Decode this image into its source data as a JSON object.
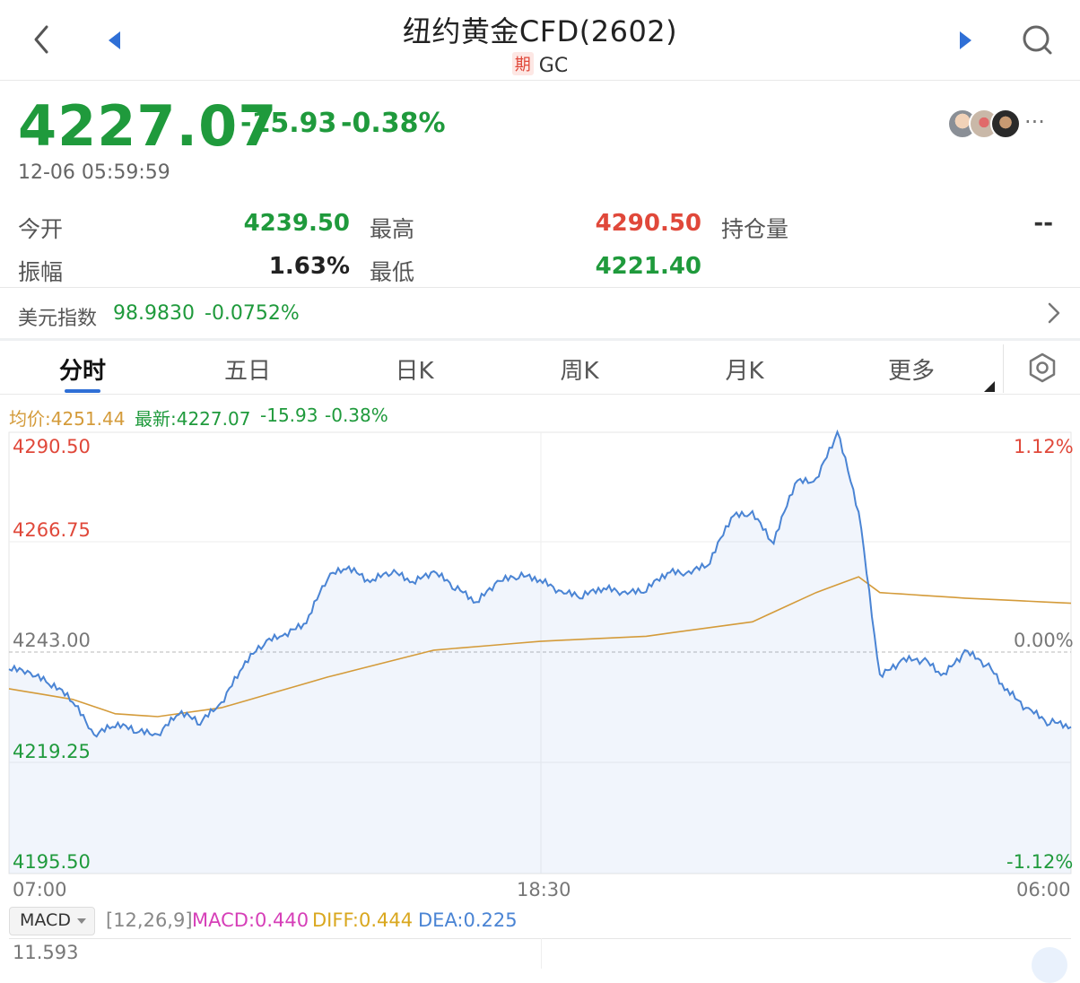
{
  "header": {
    "title": "纽约黄金CFD(2602)",
    "badge": "期",
    "code": "GC"
  },
  "quote": {
    "price": "4227.07",
    "change": "-15.93",
    "change_pct": "-0.38%",
    "timestamp": "12-06 05:59:59",
    "more": "···"
  },
  "stats": {
    "open_label": "今开",
    "open_value": "4239.50",
    "high_label": "最高",
    "high_value": "4290.50",
    "oi_label": "持仓量",
    "oi_value": "--",
    "amp_label": "振幅",
    "amp_value": "1.63%",
    "low_label": "最低",
    "low_value": "4221.40"
  },
  "usd_index": {
    "label": "美元指数",
    "value": "98.9830",
    "change_pct": "-0.0752%"
  },
  "tabs": [
    "分时",
    "五日",
    "日K",
    "周K",
    "月K",
    "更多"
  ],
  "active_tab": "分时",
  "legend": {
    "avg": "均价:4251.44",
    "latest": "最新:4227.07",
    "change": "-15.93",
    "change_pct": "-0.38%"
  },
  "axis": {
    "left": [
      "4290.50",
      "4266.75",
      "4243.00",
      "4219.25",
      "4195.50"
    ],
    "right_top": "1.12%",
    "right_mid": "0.00%",
    "right_bottom": "-1.12%",
    "x": [
      "07:00",
      "18:30",
      "06:00"
    ]
  },
  "macd": {
    "selector": "MACD",
    "params": "[12,26,9]",
    "macd": "MACD:0.440",
    "diff": "DIFF:0.444",
    "dea": "DEA:0.225",
    "axis_top": "11.593"
  },
  "colors": {
    "up": "#e0483a",
    "down": "#1f9a3c",
    "price_line": "#4a84d4",
    "avg_line": "#d49b3a",
    "accent": "#2f6fd6"
  },
  "chart_data": {
    "type": "line",
    "title": "",
    "xlabel": "",
    "ylabel": "",
    "x_ticks": [
      "07:00",
      "18:30",
      "06:00"
    ],
    "ylim": [
      4195.5,
      4290.5
    ],
    "reference": 4243.0,
    "series": [
      {
        "name": "最新",
        "x": [
          0,
          1,
          2,
          3,
          4,
          5,
          6,
          7,
          8,
          9,
          10,
          11,
          12,
          13,
          14,
          15,
          16,
          17,
          18,
          19,
          20,
          21,
          22,
          23,
          24,
          25,
          26,
          27,
          28,
          29,
          30,
          31,
          32,
          33,
          34,
          35,
          36,
          37,
          38,
          39,
          40,
          41,
          42,
          43,
          44,
          45,
          46,
          47,
          48,
          49,
          50
        ],
        "values": [
          4239.5,
          4238.2,
          4236.0,
          4232.5,
          4224.8,
          4227.3,
          4226.0,
          4224.8,
          4229.9,
          4227.8,
          4231.7,
          4239.8,
          4245.0,
          4246.5,
          4249.2,
          4259.2,
          4261.0,
          4257.9,
          4260.4,
          4257.8,
          4260.1,
          4256.9,
          4253.5,
          4257.9,
          4259.4,
          4258.4,
          4255.6,
          4255.0,
          4256.7,
          4255.4,
          4256.3,
          4260.1,
          4259.7,
          4262.2,
          4272.1,
          4272.6,
          4266.4,
          4279.5,
          4279.7,
          4290.3,
          4273.5,
          4237.5,
          4241.0,
          4241.5,
          4237.8,
          4243.0,
          4240.5,
          4234.5,
          4230.4,
          4227.8,
          4227.07
        ]
      },
      {
        "name": "均价",
        "x": [
          0,
          3,
          5,
          7,
          10,
          15,
          20,
          25,
          30,
          35,
          38,
          40,
          41,
          43,
          45,
          50
        ],
        "values": [
          4235.3,
          4233.0,
          4229.9,
          4229.3,
          4231.2,
          4237.8,
          4243.6,
          4245.5,
          4246.6,
          4249.7,
          4256.0,
          4259.4,
          4256.0,
          4255.4,
          4254.8,
          4253.7
        ]
      }
    ]
  }
}
